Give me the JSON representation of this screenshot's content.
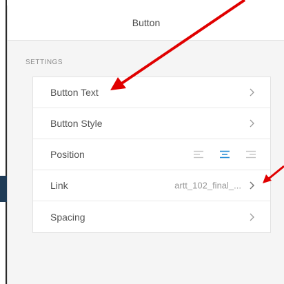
{
  "panel": {
    "title": "Button",
    "section_label": "SETTINGS"
  },
  "settings": {
    "button_text": {
      "label": "Button Text",
      "icon": "chevron-right-icon"
    },
    "button_style": {
      "label": "Button Style",
      "icon": "chevron-right-icon"
    },
    "position": {
      "label": "Position",
      "options": [
        "align-left-icon",
        "align-center-icon",
        "align-right-icon"
      ],
      "selected": "align-center-icon"
    },
    "link": {
      "label": "Link",
      "value": "artt_102_final_...",
      "icon": "chevron-right-icon"
    },
    "spacing": {
      "label": "Spacing",
      "icon": "chevron-right-icon"
    }
  },
  "colors": {
    "accent": "#2a8fd6",
    "annotation_arrow": "#e00000"
  }
}
